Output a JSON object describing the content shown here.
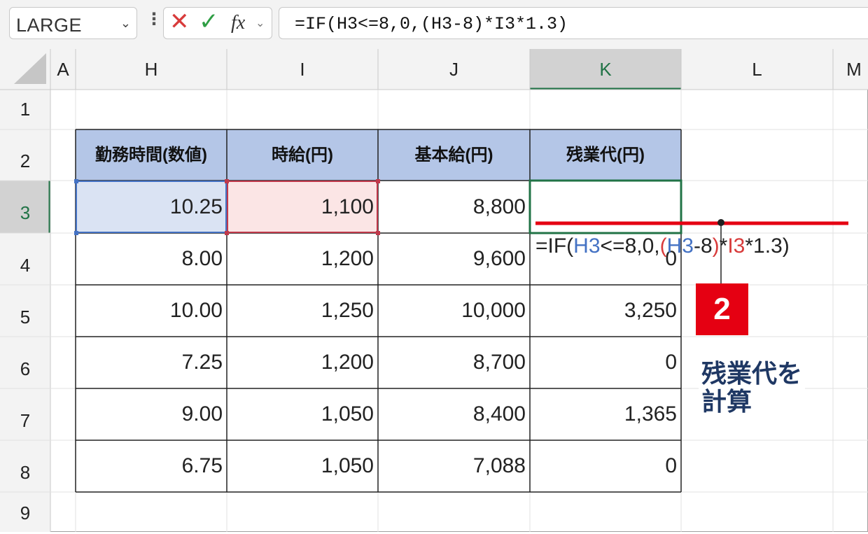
{
  "formula_bar": {
    "name_box": "LARGE",
    "name_box_chevron": "⌄",
    "more_dots": "⋮",
    "cancel_icon": "✕",
    "enter_icon": "✓",
    "fx_label": "fx",
    "fx_chevron": "⌄",
    "formula": "=IF(H3<=8,0,(H3-8)*I3*1.3)"
  },
  "columns": [
    "A",
    "H",
    "I",
    "J",
    "K",
    "L",
    "M"
  ],
  "rows": [
    "1",
    "2",
    "3",
    "4",
    "5",
    "6",
    "7",
    "8",
    "9"
  ],
  "table": {
    "headers": [
      "勤務時間(数値)",
      "時給(円)",
      "基本給(円)",
      "残業代(円)"
    ],
    "rows": [
      [
        "10.25",
        "1,100",
        "8,800",
        ""
      ],
      [
        "8.00",
        "1,200",
        "9,600",
        "0"
      ],
      [
        "10.00",
        "1,250",
        "10,000",
        "3,250"
      ],
      [
        "7.25",
        "1,200",
        "8,700",
        "0"
      ],
      [
        "9.00",
        "1,050",
        "8,400",
        "1,365"
      ],
      [
        "6.75",
        "1,050",
        "7,088",
        "0"
      ]
    ]
  },
  "editing_formula": {
    "p1": "=IF(",
    "h3a": "H3",
    "p2": "<=8,0,",
    "open": "(",
    "h3b": "H3",
    "p3": "-8",
    "close": ")",
    "star": "*",
    "i3": "I3",
    "p4": "*1.3)"
  },
  "annotation": {
    "badge": "2",
    "text_line1": "残業代を",
    "text_line2": "計算"
  },
  "colors": {
    "header_fill": "#b4c6e7",
    "h3_highlight": "#dae3f3",
    "i3_highlight": "#fbe5e5",
    "active_cell_border": "#217346",
    "callout_red": "#e50012"
  }
}
